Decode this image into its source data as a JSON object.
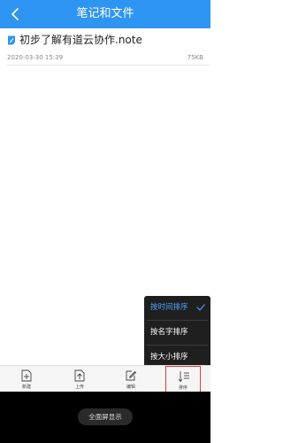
{
  "header": {
    "title": "笔记和文件"
  },
  "file": {
    "name": "初步了解有道云协作.note",
    "date": "2020-03-30 15:39",
    "size": "75KB"
  },
  "sort_menu": {
    "items": [
      {
        "label": "按时间排序",
        "active": true
      },
      {
        "label": "按名字排序",
        "active": false
      },
      {
        "label": "按大小排序",
        "active": false
      }
    ]
  },
  "toolbar": {
    "new_label": "新建",
    "upload_label": "上传",
    "edit_label": "编辑",
    "sort_label": "排序"
  },
  "bottom": {
    "fullscreen_label": "全面屏显示"
  },
  "colors": {
    "brand": "#2f95f2",
    "menu_bg": "#1f1f1f",
    "active": "#4ea1ff",
    "highlight_border": "#e53935"
  }
}
